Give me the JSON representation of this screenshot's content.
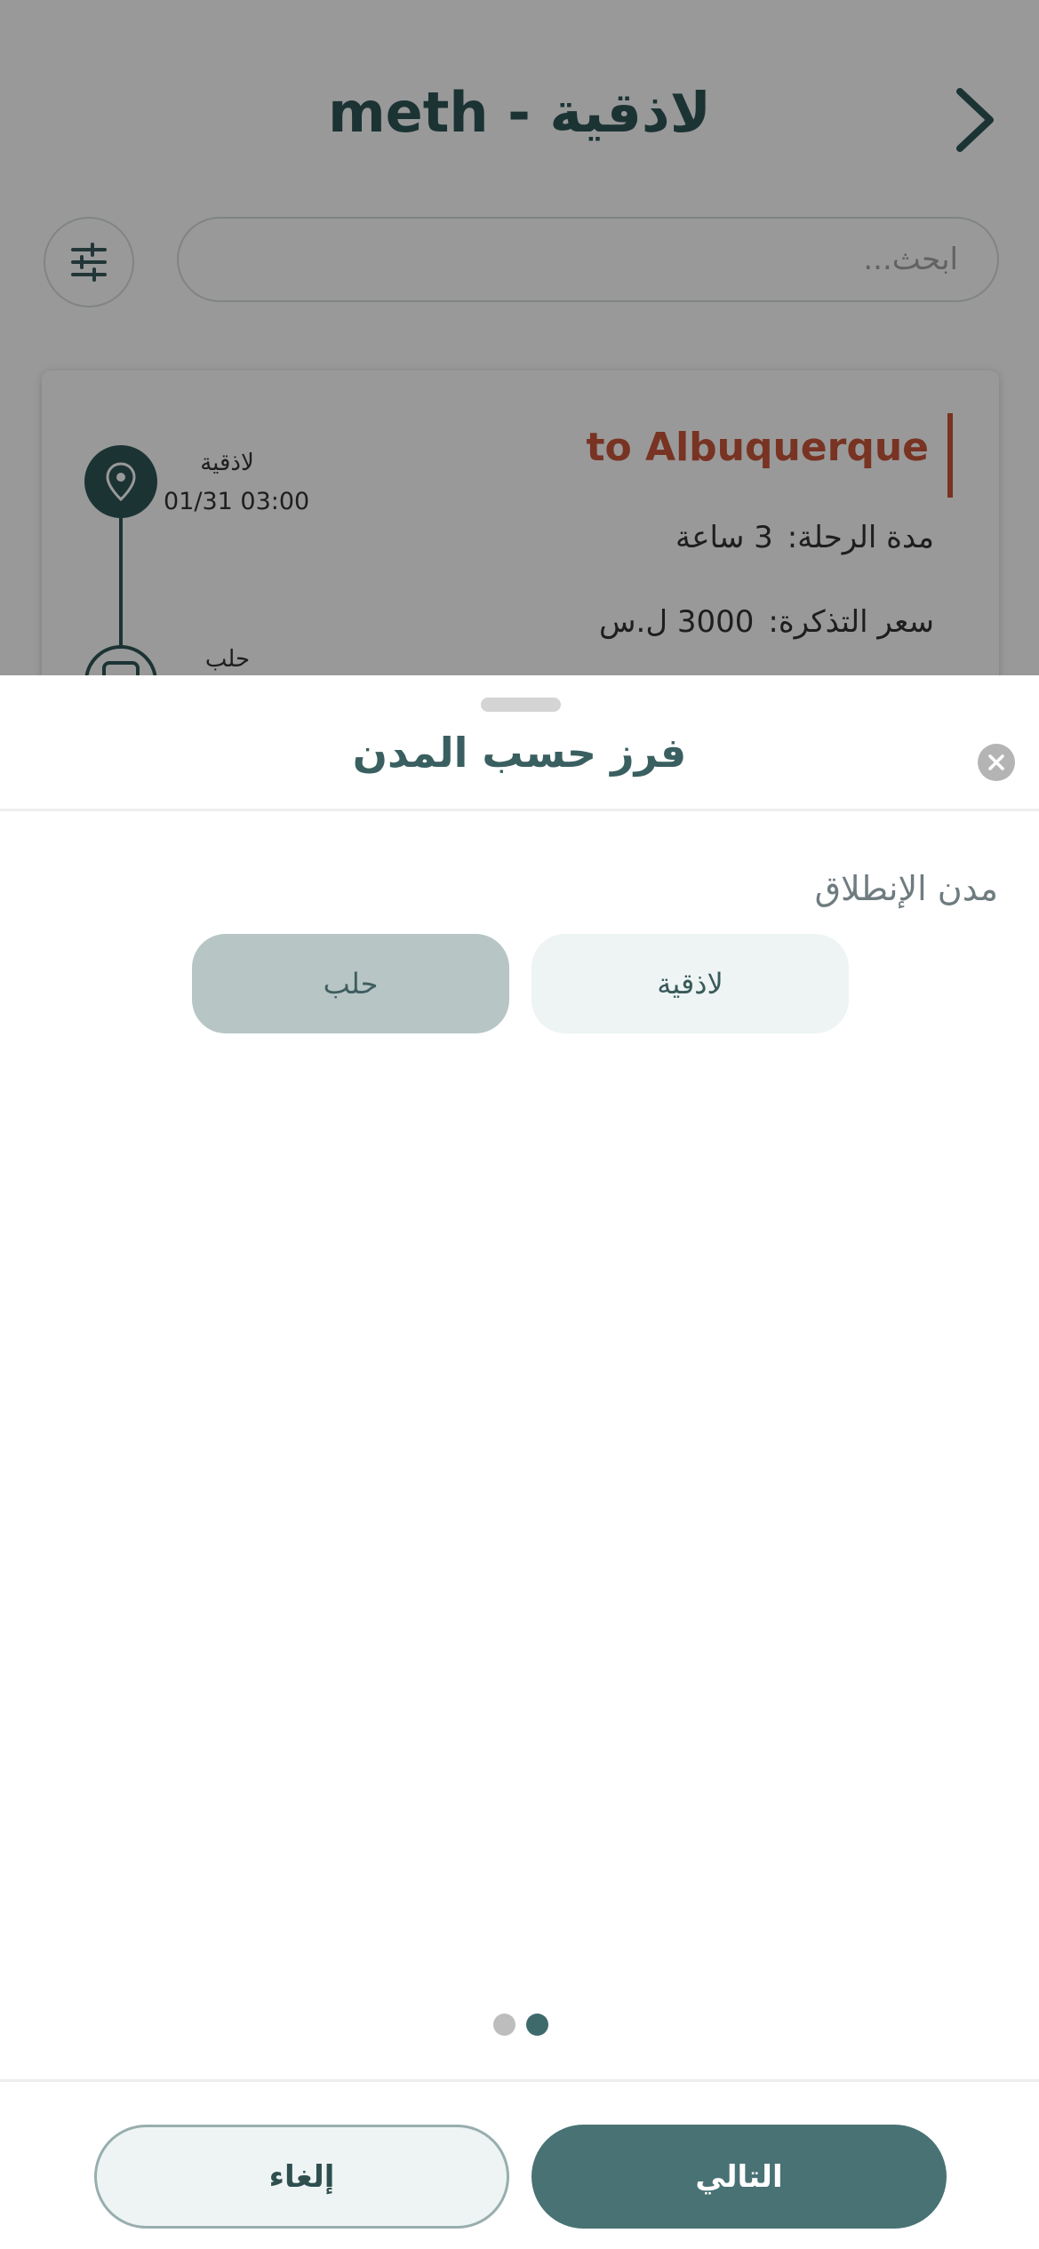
{
  "header": {
    "title": "meth - لاذقية"
  },
  "search": {
    "placeholder": "ابحث..."
  },
  "trip_card": {
    "title": "to Albuquerque",
    "duration_label": "مدة الرحلة:",
    "duration_value": "3 ساعة",
    "price_label": "سعر التذكرة:",
    "price_value": "3000 ل.س",
    "stops": [
      {
        "name": "لاذقية",
        "time": "01/31 03:00"
      },
      {
        "name": "حلب"
      }
    ]
  },
  "sheet": {
    "title": "فرز حسب المدن",
    "section_label": "مدن الإنطلاق",
    "chips": [
      {
        "label": "لاذقية",
        "selected": false
      },
      {
        "label": "حلب",
        "selected": true
      }
    ],
    "pagination": {
      "current": 2,
      "total": 2
    },
    "cancel_label": "إلغاء",
    "next_label": "التالي"
  },
  "colors": {
    "primary": "#497274",
    "accent": "#c9553a",
    "chip_selected": "#b7c5c5",
    "chip_default": "#eef4f4"
  },
  "icons": [
    "chevron-right-icon",
    "sliders-icon",
    "location-pin-icon",
    "bus-icon",
    "close-icon"
  ]
}
